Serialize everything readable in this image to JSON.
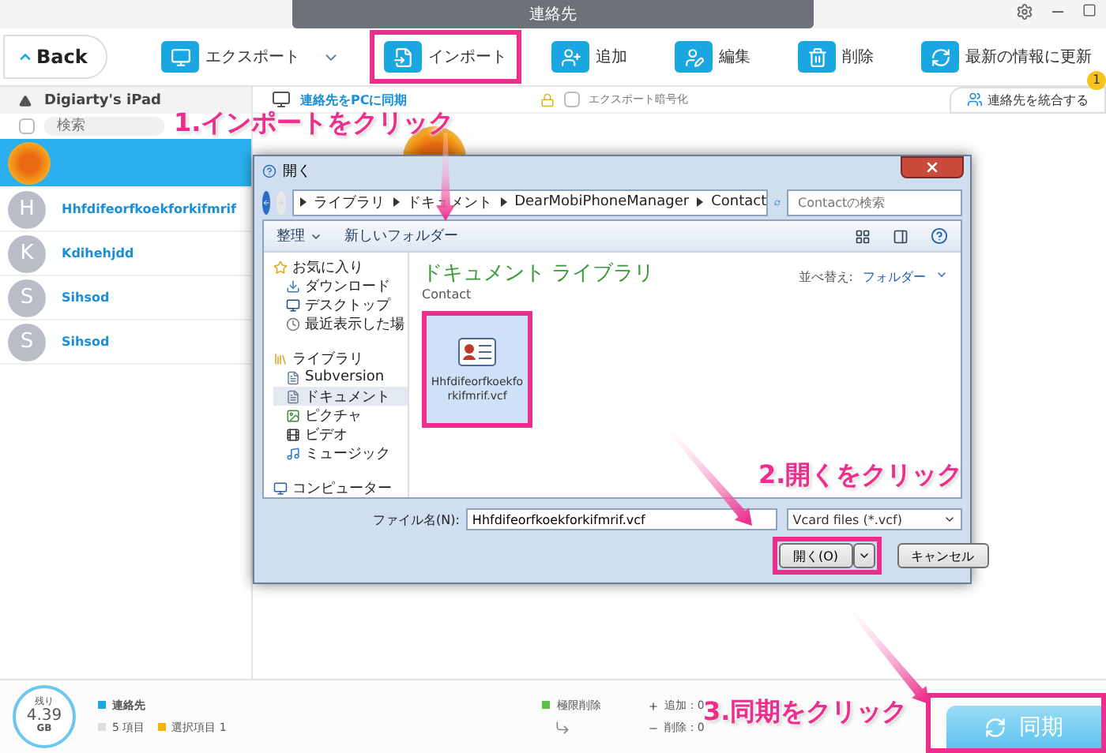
{
  "window": {
    "title": "連絡先"
  },
  "toolbar": {
    "back": "Back",
    "items": [
      {
        "label": "エクスポート",
        "dropdown": true,
        "highlighted": false
      },
      {
        "label": "インポート",
        "dropdown": false,
        "highlighted": true
      },
      {
        "label": "追加",
        "dropdown": false,
        "highlighted": false
      },
      {
        "label": "編集",
        "dropdown": false,
        "highlighted": false
      },
      {
        "label": "削除",
        "dropdown": false,
        "highlighted": false
      },
      {
        "label": "最新の情報に更新",
        "dropdown": false,
        "highlighted": false
      }
    ]
  },
  "sidebar": {
    "device": "Digiarty's iPad",
    "select_all": {
      "checked": false
    },
    "search": {
      "placeholder": "検索"
    },
    "contacts": [
      {
        "kind": "photo",
        "selected": true
      },
      {
        "kind": "letter",
        "initial": "H",
        "name": "Hhfdifeorfkoekforkifmrif",
        "selected": false
      },
      {
        "kind": "letter",
        "initial": "K",
        "name": "Kdihehjdd",
        "selected": false
      },
      {
        "kind": "letter",
        "initial": "S",
        "name": "Sihsod",
        "selected": false
      },
      {
        "kind": "letter",
        "initial": "S",
        "name": "Sihsod",
        "selected": false
      }
    ]
  },
  "main": {
    "sync_link": "連絡先をPCに同期",
    "encrypt": {
      "label": "エクスポート暗号化",
      "checked": false
    },
    "merge": {
      "label": "連絡先を統合する",
      "badge": "1"
    }
  },
  "dialog": {
    "title": "開く",
    "breadcrumbs": [
      "ライブラリ",
      "ドキュメント",
      "DearMobiPhoneManager",
      "Contact"
    ],
    "search": {
      "placeholder": "Contactの検索"
    },
    "commands": [
      {
        "label": "整理",
        "dropdown": true
      },
      {
        "label": "新しいフォルダー",
        "dropdown": false
      }
    ],
    "nav": [
      {
        "label": "お気に入り",
        "selected": false,
        "children": [
          {
            "label": "ダウンロード",
            "selected": false
          },
          {
            "label": "デスクトップ",
            "selected": false
          },
          {
            "label": "最近表示した場",
            "selected": false
          }
        ]
      },
      {
        "label": "ライブラリ",
        "selected": false,
        "children": [
          {
            "label": "Subversion",
            "selected": false
          },
          {
            "label": "ドキュメント",
            "selected": true
          },
          {
            "label": "ピクチャ",
            "selected": false
          },
          {
            "label": "ビデオ",
            "selected": false
          },
          {
            "label": "ミュージック",
            "selected": false
          }
        ]
      },
      {
        "label": "コンピューター",
        "selected": false
      }
    ],
    "library_title": "ドキュメント ライブラリ",
    "library_subtitle": "Contact",
    "sort_label": "並べ替え:",
    "sort_value": "フォルダー",
    "files": [
      {
        "name": "Hhfdifeorfkoekforkifmrif.vcf",
        "selected": true,
        "highlighted": true
      }
    ],
    "filename_label": "ファイル名(N):",
    "filename": "Hhfdifeorfkoekforkifmrif.vcf",
    "filetype": "Vcard files (*.vcf)",
    "open": {
      "label": "開く(O)",
      "highlighted": true
    },
    "cancel": "キャンセル"
  },
  "annotations": [
    {
      "text": "1.インポートをクリック"
    },
    {
      "text": "2.開くをクリック"
    },
    {
      "text": "3.同期をクリック"
    }
  ],
  "status_bar": {
    "storage_label": "残り",
    "storage_value": "4.39",
    "storage_unit": "GB",
    "category": "連絡先",
    "count": "5 項目",
    "selected_count": "選択項目 1",
    "mode": "極限削除",
    "added": "追加：0",
    "deleted": "削除：0",
    "sync": "同期",
    "sync_highlighted": true
  }
}
